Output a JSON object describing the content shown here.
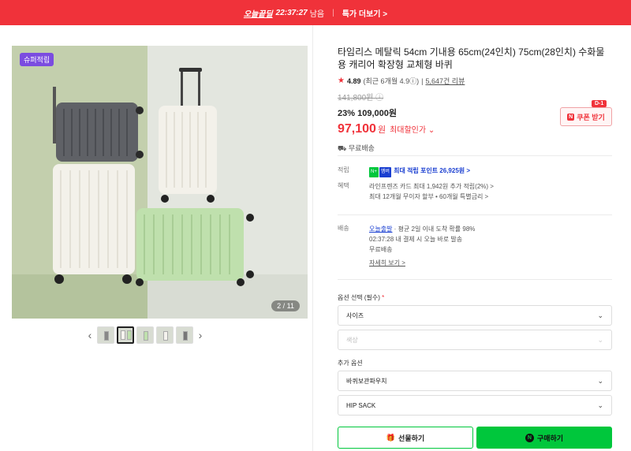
{
  "banner": {
    "brand": "오늘끝딜",
    "timer": "22:37:27",
    "remaining": "남음",
    "link": "특가 더보기 >"
  },
  "gallery": {
    "badge": "슈퍼적립",
    "counter": "2 / 11",
    "prev": "‹",
    "next": "›"
  },
  "product": {
    "title": "타임리스 메탈릭 54cm 기내용 65cm(24인치) 75cm(28인치) 수화물용 캐리어 확장형 교체형 바퀴",
    "rating": "4.89",
    "recent_rating": "(최근 6개월 4.9ⓘ)",
    "reviews": "5,647건 리뷰",
    "original_price": "141,800원 ⓘ",
    "discount_rate": "23%",
    "discount_price": "109,000원",
    "final_price": "97,100",
    "won": "원",
    "max_discount": "최대할인가 ⌄",
    "shipping_short": "무료배송"
  },
  "coupon": {
    "dday": "D-1",
    "label": "쿠폰 받기",
    "n": "N"
  },
  "points": {
    "label": "적립",
    "badge1": "N+",
    "badge2": "멤버",
    "text": "최대 적립 포인트 26,925원 >"
  },
  "benefits": {
    "label": "혜택",
    "line1": "라인프렌즈 카드 최대 1,942원 추가 적립(2%) >",
    "line2": "최대 12개월 무이자 할부 • 60개월 특별금리 >"
  },
  "delivery": {
    "label": "배송",
    "today": "오늘출발",
    "line1": " · 평균 2일 이내 도착 확률 98%",
    "line2": "02:37:28  내 결제 시 오늘 바로 발송",
    "line3": "무료배송",
    "details": "자세히 보기 >"
  },
  "options": {
    "required_label": "옵션 선택 (필수)",
    "required_mark": "*",
    "size_placeholder": "사이즈",
    "color_placeholder": "색상",
    "extra_label": "추가 옵션",
    "extra1": "바퀴보관파우치",
    "extra2": "HIP SACK"
  },
  "actions": {
    "gift": "선물하기",
    "buy": "구매하기",
    "buy_icon": "N"
  },
  "colors": {
    "accent_red": "#f0323a",
    "naver_green": "#00c73c",
    "link_blue": "#1a3fd1"
  }
}
